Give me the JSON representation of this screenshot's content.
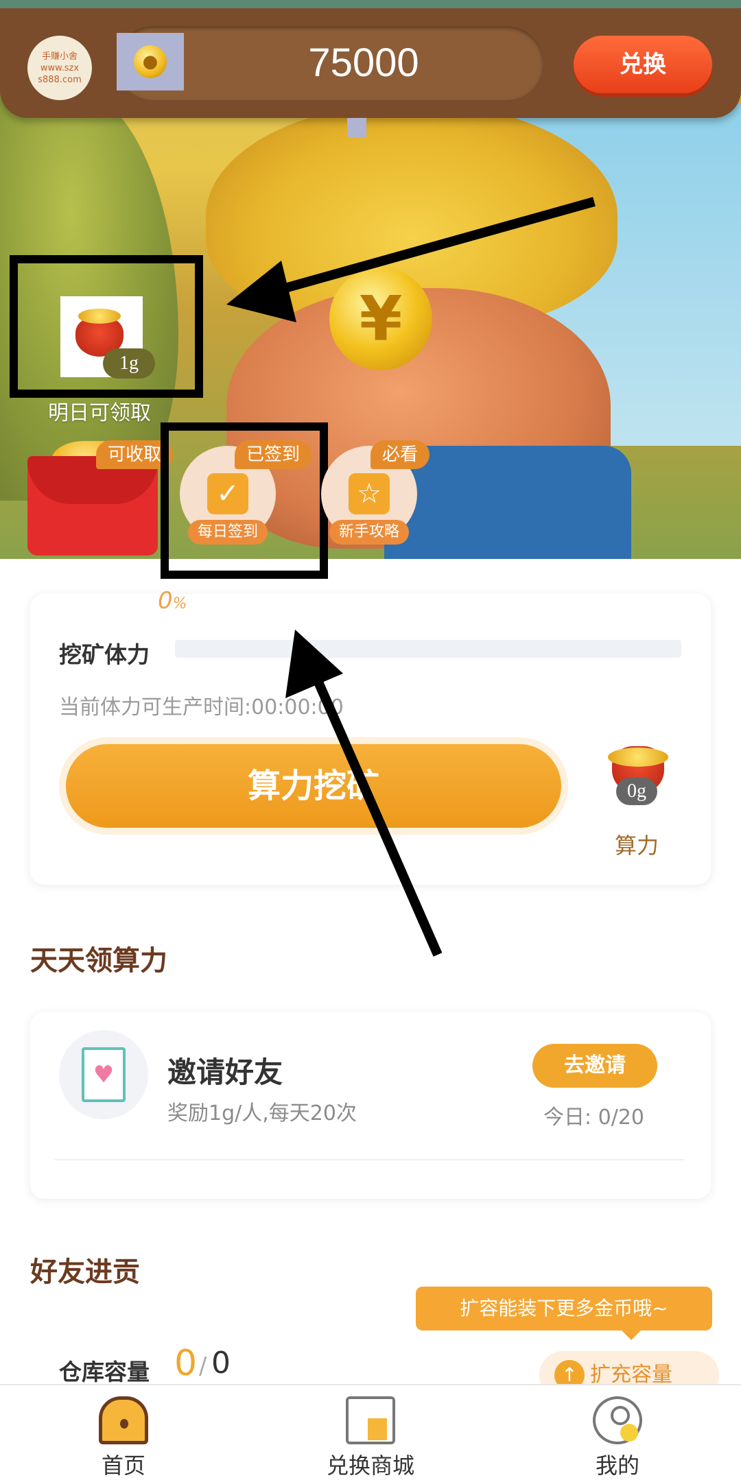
{
  "header": {
    "logo_lines": [
      "手赚小舍",
      "www.szx",
      "s888.com"
    ],
    "coin_balance": "75000",
    "exchange_label": "兑换"
  },
  "hero": {
    "gift_amount": "1g",
    "gift_caption": "明日可领取",
    "quick_icons": [
      {
        "tag": "可收取",
        "label": ""
      },
      {
        "tag": "已签到",
        "label": "每日签到"
      },
      {
        "tag": "必看",
        "label": "新手攻略"
      }
    ]
  },
  "mining": {
    "progress_value": "0",
    "progress_unit": "%",
    "progress_fraction": 0,
    "stamina_label": "挖矿体力",
    "time_text": "当前体力可生产时间:00:00:00",
    "mine_button": "算力挖矿",
    "side_amount": "0g",
    "side_label": "算力"
  },
  "daily_section": {
    "title": "天天领算力",
    "invite": {
      "title": "邀请好友",
      "desc": "奖励1g/人,每天20次",
      "button": "去邀请",
      "count": "今日: 0/20"
    }
  },
  "friends_section": {
    "title": "好友进贡",
    "tooltip": "扩容能装下更多金币哦~",
    "warehouse_label": "仓库容量",
    "warehouse_used": "0",
    "warehouse_sep": "/",
    "warehouse_capacity": "0",
    "expand_button": "扩充容量"
  },
  "bottom_nav": [
    {
      "label": "首页",
      "icon": "home-icon"
    },
    {
      "label": "兑换商城",
      "icon": "shop-icon"
    },
    {
      "label": "我的",
      "icon": "profile-icon"
    }
  ],
  "colors": {
    "header_brown": "#7a4c2c",
    "accent_orange": "#f1a72c",
    "exchange_red": "#e8401a",
    "title_brown": "#6b3b20"
  }
}
